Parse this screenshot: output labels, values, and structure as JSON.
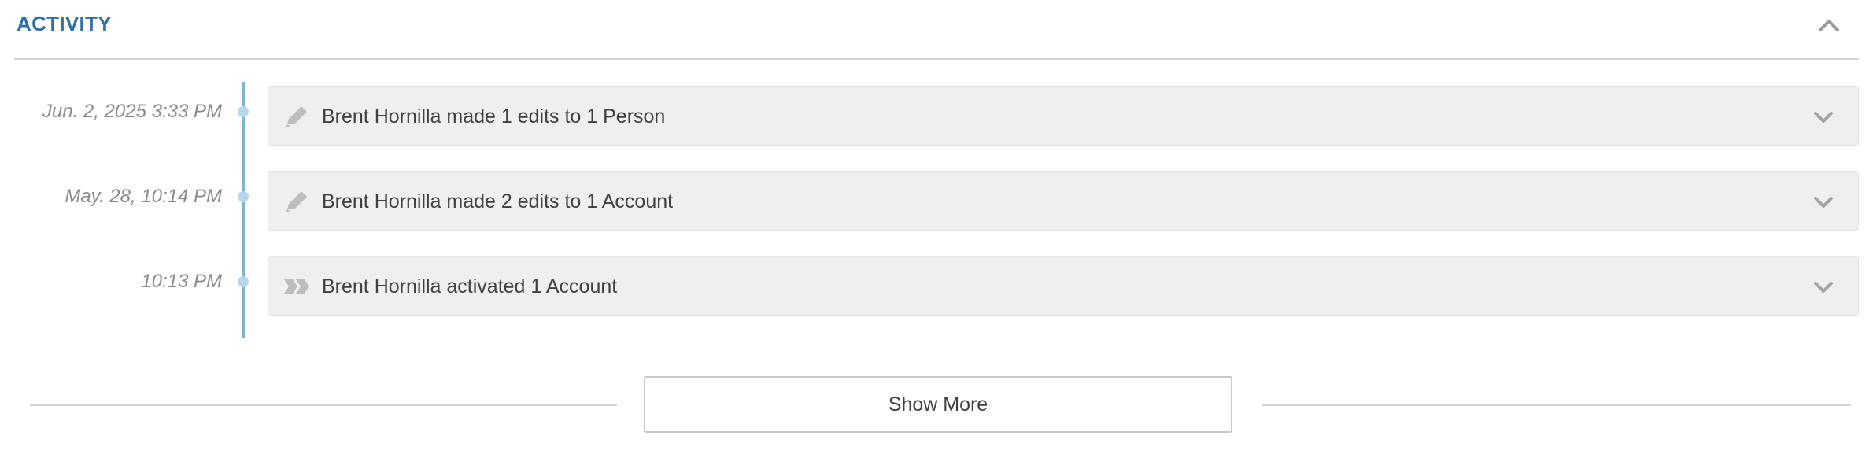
{
  "section": {
    "title": "ACTIVITY",
    "collapse_icon": "chevron-up-icon"
  },
  "timeline": [
    {
      "timestamp": "Jun. 2, 2025 3:33 PM",
      "icon": "pencil-icon",
      "text": "Brent Hornilla made 1 edits to 1 Person",
      "expand_icon": "chevron-down-icon"
    },
    {
      "timestamp": "May. 28, 10:14 PM",
      "icon": "pencil-icon",
      "text": "Brent Hornilla made 2 edits to 1 Account",
      "expand_icon": "chevron-down-icon"
    },
    {
      "timestamp": "10:13 PM",
      "icon": "activate-icon",
      "text": "Brent Hornilla activated 1 Account",
      "expand_icon": "chevron-down-icon"
    }
  ],
  "show_more_label": "Show More",
  "colors": {
    "accent": "#2f6fa8",
    "timeline": "#7fb3d3",
    "item_bg": "#efefef"
  }
}
